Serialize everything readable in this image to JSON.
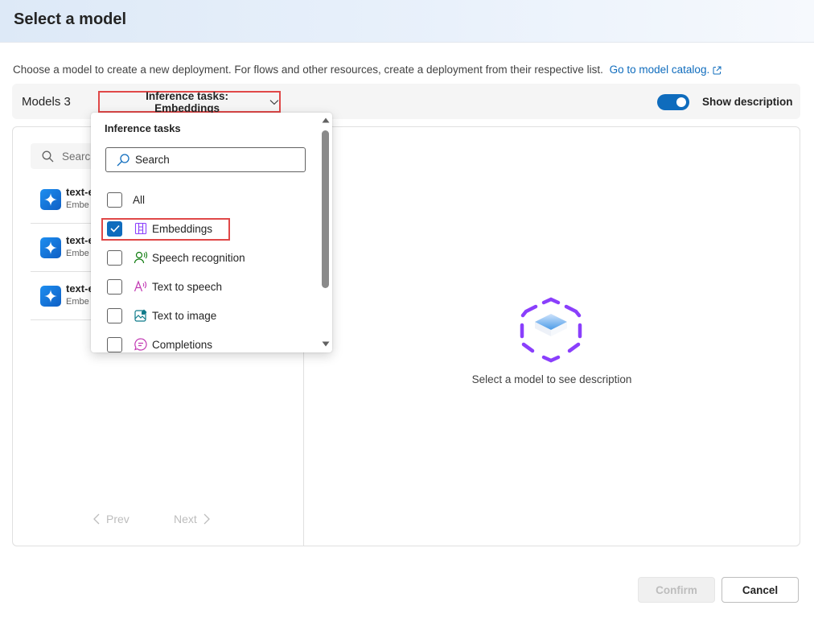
{
  "dialog": {
    "title": "Select a model",
    "intro": "Choose a model to create a new deployment. For flows and other resources, create a deployment from their respective list.",
    "catalog_link": "Go to model catalog."
  },
  "toolbar": {
    "models_label": "Models 3",
    "filter_label": "Inference tasks: Embeddings",
    "show_description_label": "Show description",
    "show_description_on": true
  },
  "left": {
    "search_placeholder": "Search",
    "models": [
      {
        "name": "text-e",
        "subtitle": "Embe"
      },
      {
        "name": "text-e",
        "subtitle": "Embe"
      },
      {
        "name": "text-e",
        "subtitle": "Embe"
      }
    ],
    "prev_label": "Prev",
    "next_label": "Next"
  },
  "right": {
    "placeholder_text": "Select a model to see description"
  },
  "dropdown": {
    "title": "Inference tasks",
    "search_placeholder": "Search",
    "options": [
      {
        "label": "All",
        "checked": false,
        "icon": "none"
      },
      {
        "label": "Embeddings",
        "checked": true,
        "icon": "embeddings-icon"
      },
      {
        "label": "Speech recognition",
        "checked": false,
        "icon": "speech-recognition-icon"
      },
      {
        "label": "Text to speech",
        "checked": false,
        "icon": "text-to-speech-icon"
      },
      {
        "label": "Text to image",
        "checked": false,
        "icon": "text-to-image-icon"
      },
      {
        "label": "Completions",
        "checked": false,
        "icon": "completions-icon"
      }
    ]
  },
  "footer": {
    "confirm_label": "Confirm",
    "cancel_label": "Cancel"
  },
  "colors": {
    "accent": "#0f6cbd",
    "highlight": "#e04848",
    "purple": "#8a3ffc"
  }
}
